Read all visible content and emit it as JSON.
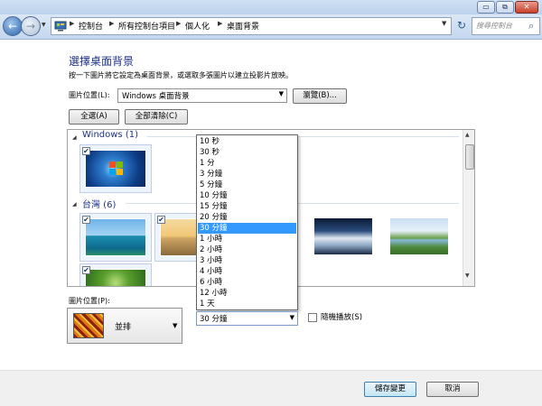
{
  "window": {
    "caption_buttons": {
      "minimize": "▭",
      "maximize": "⧉",
      "close": "✕"
    }
  },
  "nav": {
    "back_icon": "arrow-left-icon",
    "forward_icon": "arrow-right-icon",
    "breadcrumbs": [
      "控制台",
      "所有控制台項目",
      "個人化",
      "桌面背景"
    ],
    "search_placeholder": "搜尋控制台"
  },
  "page": {
    "title": "選擇桌面背景",
    "description": "按一下圖片將它設定為桌面背景，或選取多張圖片以建立投影片放映。",
    "location_label": "圖片位置(L):",
    "location_value": "Windows 桌面背景",
    "browse_label": "瀏覽(B)...",
    "select_all_label": "全選(A)",
    "clear_all_label": "全部清除(C)"
  },
  "picture_groups": [
    {
      "title": "Windows (1)",
      "items": [
        {
          "checked": true
        }
      ]
    },
    {
      "title": "台灣 (6)",
      "items": [
        {
          "checked": true
        },
        {
          "checked": true
        },
        {
          "checked": false
        },
        {
          "checked": false
        },
        {
          "checked": false
        },
        {
          "checked": true
        }
      ]
    }
  ],
  "position": {
    "label": "圖片位置(P):",
    "value": "並排"
  },
  "time": {
    "options": [
      "10 秒",
      "30 秒",
      "1 分",
      "3 分鐘",
      "5 分鐘",
      "10 分鐘",
      "15 分鐘",
      "20 分鐘",
      "30 分鐘",
      "1 小時",
      "2 小時",
      "3 小時",
      "4 小時",
      "6 小時",
      "12 小時",
      "1 天"
    ],
    "selected": "30 分鐘",
    "shuffle_label": "隨機播放(S)",
    "shuffle_checked": false
  },
  "buttons": {
    "save": "儲存變更",
    "cancel": "取消"
  },
  "colors": {
    "accent": "#1e3287",
    "selection": "#3399ff"
  }
}
